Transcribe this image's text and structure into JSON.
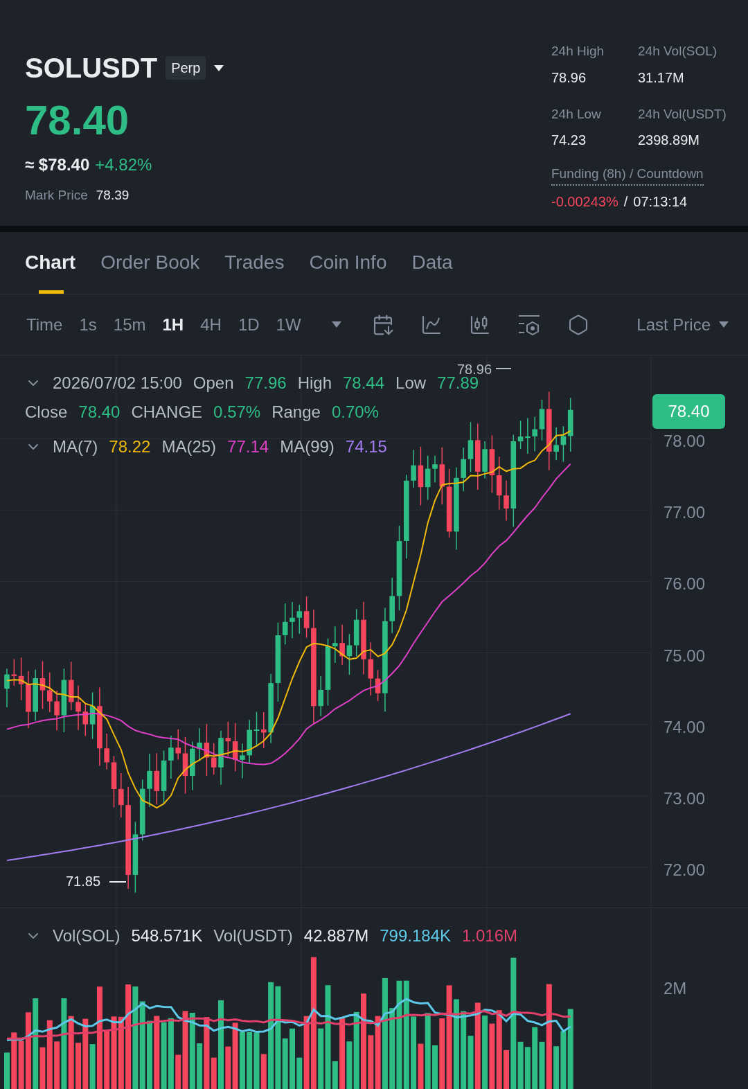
{
  "header": {
    "symbol": "SOLUSDT",
    "contract_badge": "Perp",
    "price": "78.40",
    "price_usd": "≈ $78.40",
    "change": "+4.82%",
    "mark_price_label": "Mark Price",
    "mark_price": "78.39"
  },
  "stats": [
    {
      "label": "24h High",
      "value": "78.96"
    },
    {
      "label": "24h Vol(SOL)",
      "value": "31.17M"
    },
    {
      "label": "24h Low",
      "value": "74.23"
    },
    {
      "label": "24h Vol(USDT)",
      "value": "2398.89M"
    }
  ],
  "funding": {
    "label": "Funding (8h) / Countdown",
    "rate": "-0.00243%",
    "separator": "/",
    "countdown": "07:13:14"
  },
  "tabs": [
    {
      "label": "Chart",
      "selected": true
    },
    {
      "label": "Order Book",
      "selected": false
    },
    {
      "label": "Trades",
      "selected": false
    },
    {
      "label": "Coin Info",
      "selected": false
    },
    {
      "label": "Data",
      "selected": false
    }
  ],
  "intervals": [
    {
      "label": "Time",
      "selected": false
    },
    {
      "label": "1s",
      "selected": false
    },
    {
      "label": "15m",
      "selected": false
    },
    {
      "label": "1H",
      "selected": true
    },
    {
      "label": "4H",
      "selected": false
    },
    {
      "label": "1D",
      "selected": false
    },
    {
      "label": "1W",
      "selected": false
    }
  ],
  "price_type": "Last Price",
  "candle_info": {
    "date": "2026/07/02 15:00",
    "fields": [
      {
        "label": "Open",
        "value": "77.96"
      },
      {
        "label": "High",
        "value": "78.44"
      },
      {
        "label": "Low",
        "value": "77.89"
      },
      {
        "label": "Close",
        "value": "78.40"
      },
      {
        "label": "CHANGE",
        "value": "0.57%"
      },
      {
        "label": "Range",
        "value": "0.70%"
      }
    ]
  },
  "moving_averages": [
    {
      "label": "MA(7)",
      "value": "78.22",
      "color": "#f0b90b"
    },
    {
      "label": "MA(25)",
      "value": "77.14",
      "color": "#e040c8"
    },
    {
      "label": "MA(99)",
      "value": "74.15",
      "color": "#a27cf0"
    }
  ],
  "price_axis": [
    "78.00",
    "77.00",
    "76.00",
    "75.00",
    "74.00",
    "73.00",
    "72.00"
  ],
  "current_price_tag": "78.40",
  "high_marker": "78.96",
  "low_marker": "71.85",
  "volume": {
    "label": "Vol(SOL)",
    "value": "548.571K",
    "label_2": "Vol(USDT)",
    "value_2": "42.887M",
    "averages": [
      {
        "value": "799.184K",
        "color": "#5ec8e8"
      },
      {
        "value": "1.016M",
        "color": "#e0406a"
      }
    ],
    "axis": "2M"
  }
}
